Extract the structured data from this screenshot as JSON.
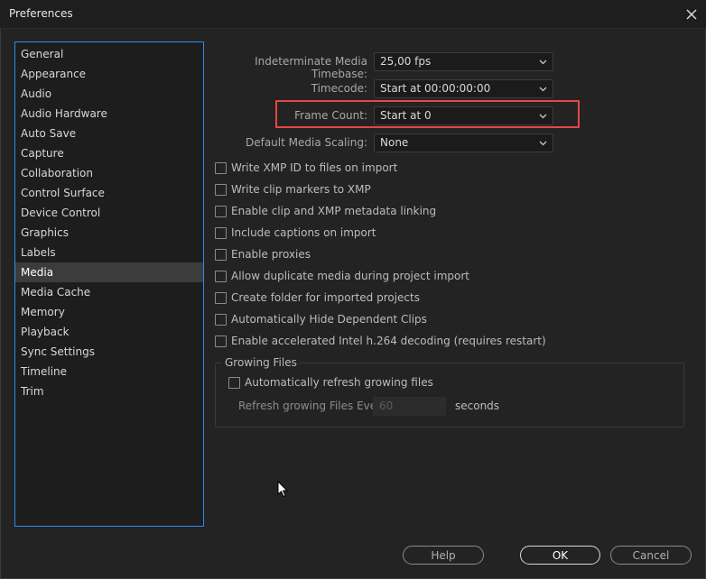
{
  "window": {
    "title": "Preferences"
  },
  "sidebar": {
    "items": [
      {
        "label": "General"
      },
      {
        "label": "Appearance"
      },
      {
        "label": "Audio"
      },
      {
        "label": "Audio Hardware"
      },
      {
        "label": "Auto Save"
      },
      {
        "label": "Capture"
      },
      {
        "label": "Collaboration"
      },
      {
        "label": "Control Surface"
      },
      {
        "label": "Device Control"
      },
      {
        "label": "Graphics"
      },
      {
        "label": "Labels"
      },
      {
        "label": "Media"
      },
      {
        "label": "Media Cache"
      },
      {
        "label": "Memory"
      },
      {
        "label": "Playback"
      },
      {
        "label": "Sync Settings"
      },
      {
        "label": "Timeline"
      },
      {
        "label": "Trim"
      }
    ],
    "selected": "Media"
  },
  "fields": {
    "timebase": {
      "label": "Indeterminate Media Timebase:",
      "value": "25,00 fps"
    },
    "timecode": {
      "label": "Timecode:",
      "value": "Start at 00:00:00:00"
    },
    "frame_count": {
      "label": "Frame Count:",
      "value": "Start at 0"
    },
    "scaling": {
      "label": "Default Media Scaling:",
      "value": "None"
    }
  },
  "checkboxes": [
    {
      "label": "Write XMP ID to files on import",
      "checked": false
    },
    {
      "label": "Write clip markers to XMP",
      "checked": false
    },
    {
      "label": "Enable clip and XMP metadata linking",
      "checked": false
    },
    {
      "label": "Include captions on import",
      "checked": false
    },
    {
      "label": "Enable proxies",
      "checked": false
    },
    {
      "label": "Allow duplicate media during project import",
      "checked": false
    },
    {
      "label": "Create folder for imported projects",
      "checked": false
    },
    {
      "label": "Automatically Hide Dependent Clips",
      "checked": false
    },
    {
      "label": "Enable accelerated Intel h.264 decoding (requires restart)",
      "checked": false
    }
  ],
  "growing_files": {
    "title": "Growing Files",
    "auto_refresh_label": "Automatically refresh growing files",
    "auto_refresh_checked": false,
    "refresh_label": "Refresh growing Files Every",
    "refresh_value": "60",
    "refresh_unit": "seconds"
  },
  "buttons": {
    "help": "Help",
    "ok": "OK",
    "cancel": "Cancel"
  },
  "colors": {
    "accent": "#2d8ceb",
    "highlight": "#e64646"
  }
}
